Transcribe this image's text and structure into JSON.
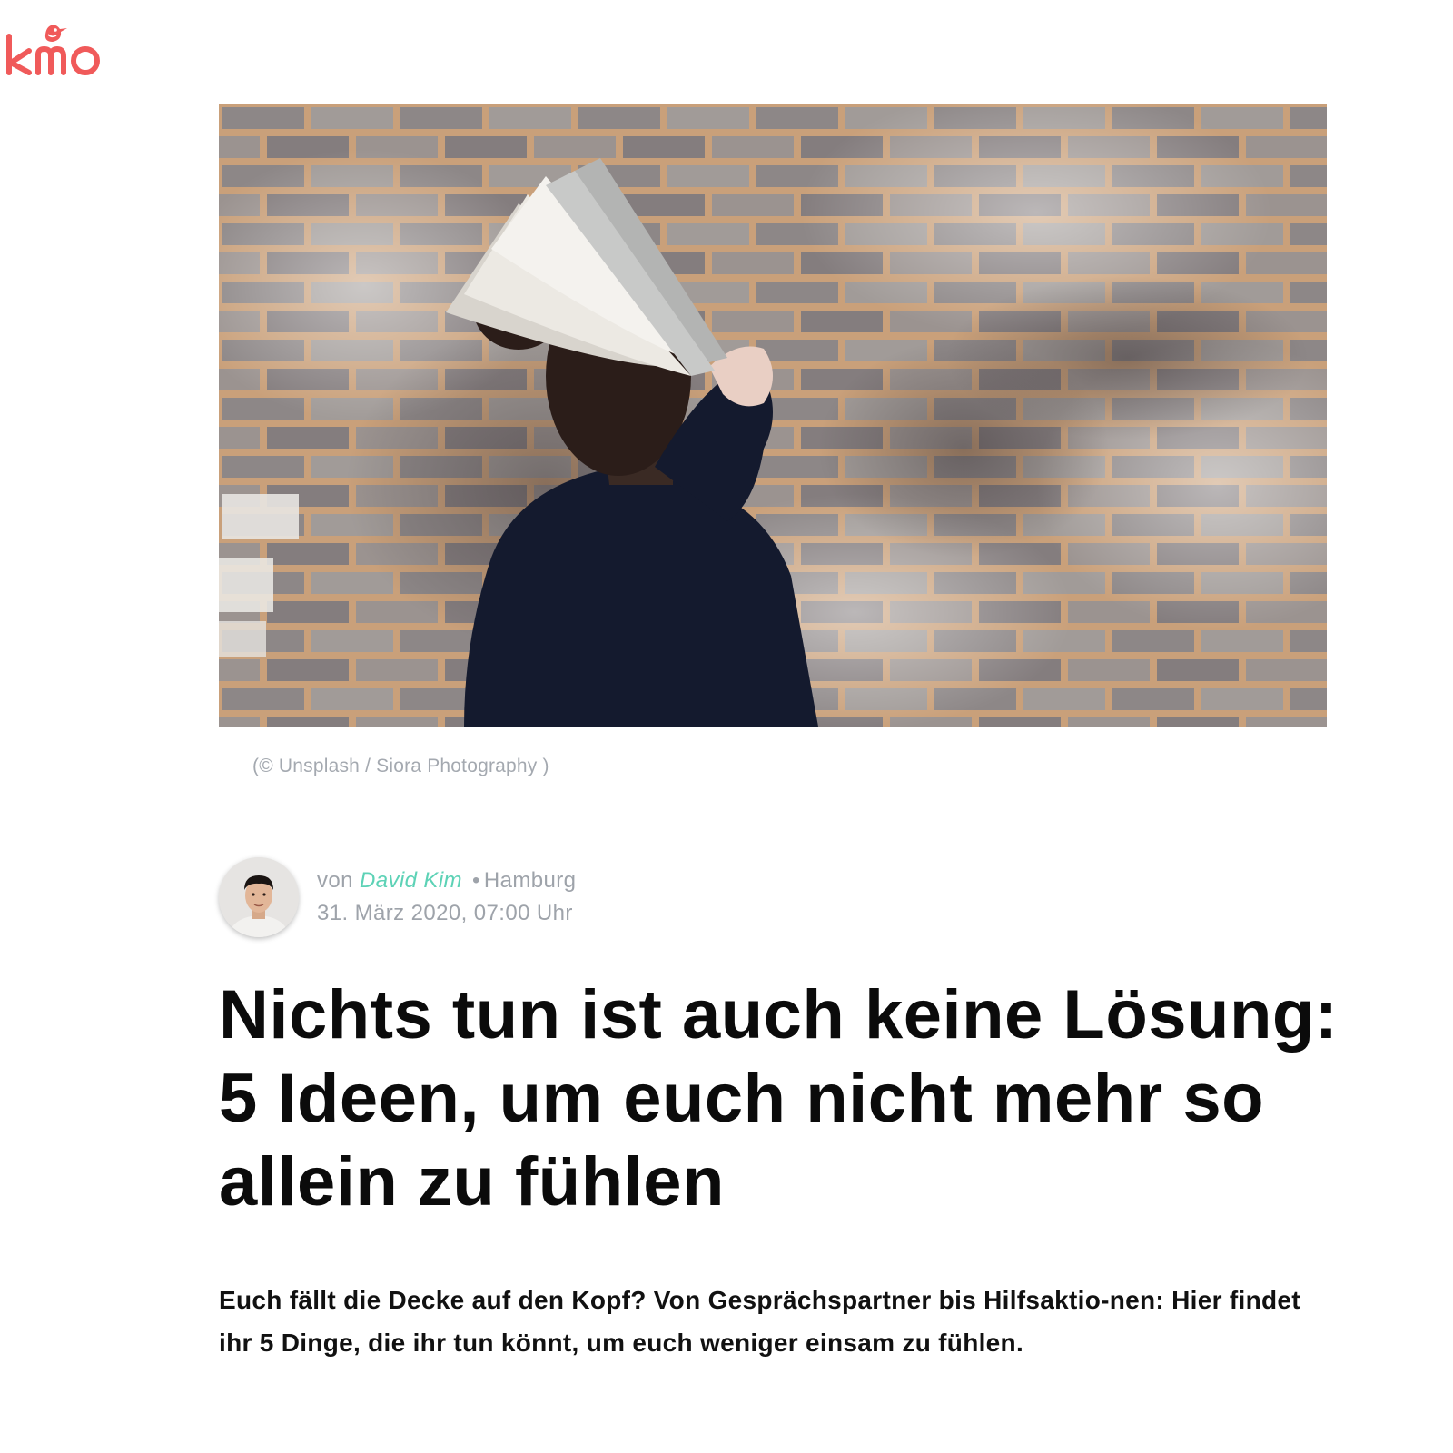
{
  "logo": {
    "text": "kmo",
    "color": "#f05a5a",
    "icon": "bird-icon"
  },
  "hero": {
    "icon": "hero-photo",
    "caption": "(© Unsplash / Siora Photography )"
  },
  "author": {
    "prefix": "von",
    "name": "David Kim",
    "separator": "•",
    "location": "Hamburg",
    "date": "31. März 2020, 07:00 Uhr",
    "name_color": "#5dd2b6"
  },
  "article": {
    "title": "Nichts tun ist auch keine Lösung: 5 Ideen, um euch nicht mehr so allein zu fühlen",
    "teaser": "Euch fällt die Decke auf den Kopf? Von Gesprächspartner bis Hilfsaktio-nen: Hier findet ihr 5 Dinge, die ihr tun könnt, um euch weniger einsam zu fühlen."
  }
}
